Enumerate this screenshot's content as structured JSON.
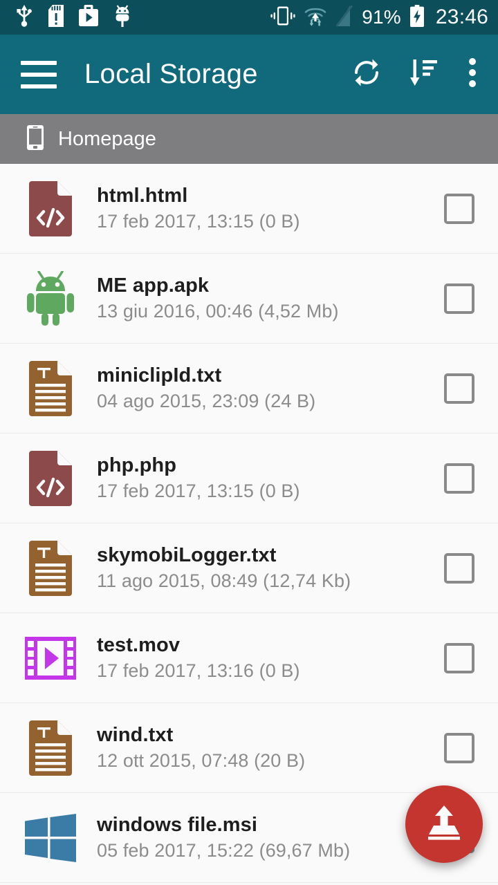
{
  "statusbar": {
    "icons_left": [
      "usb-icon",
      "sd-card-alert-icon",
      "play-store-icon",
      "android-debug-icon"
    ],
    "icons_right": [
      "vibrate-icon",
      "wifi-transfer-icon",
      "signal-off-icon"
    ],
    "battery_percent": "91%",
    "battery_state": "charging",
    "time": "23:46",
    "background_color": "#0D4E5B"
  },
  "toolbar": {
    "menu_icon": "hamburger-menu-icon",
    "title": "Local Storage",
    "actions": [
      {
        "name": "refresh",
        "icon": "refresh-icon"
      },
      {
        "name": "sort",
        "icon": "sort-descending-icon"
      },
      {
        "name": "more",
        "icon": "overflow-menu-icon"
      }
    ],
    "background_color": "#11697C"
  },
  "breadcrumb": {
    "icon": "phone-icon",
    "label": "Homepage",
    "background_color": "#7E7E80"
  },
  "files": [
    {
      "name": "html.html",
      "meta": "17 feb 2017, 13:15 (0 B)",
      "icon": "code-file-icon",
      "icon_color": "#8C4A4A",
      "checked": false
    },
    {
      "name": "ME app.apk",
      "meta": "13 giu 2016, 00:46 (4,52 Mb)",
      "icon": "android-apk-icon",
      "icon_color": "#5FA85F",
      "checked": false
    },
    {
      "name": "miniclipId.txt",
      "meta": "04 ago 2015, 23:09 (24 B)",
      "icon": "text-file-icon",
      "icon_color": "#94622E",
      "checked": false
    },
    {
      "name": "php.php",
      "meta": "17 feb 2017, 13:15 (0 B)",
      "icon": "code-file-icon",
      "icon_color": "#8C4A4A",
      "checked": false
    },
    {
      "name": "skymobiLogger.txt",
      "meta": "11 ago 2015, 08:49 (12,74 Kb)",
      "icon": "text-file-icon",
      "icon_color": "#94622E",
      "checked": false
    },
    {
      "name": "test.mov",
      "meta": "17 feb 2017, 13:16 (0 B)",
      "icon": "video-file-icon",
      "icon_color": "#C337E8",
      "checked": false
    },
    {
      "name": "wind.txt",
      "meta": "12 ott 2015, 07:48 (20 B)",
      "icon": "text-file-icon",
      "icon_color": "#94622E",
      "checked": false
    },
    {
      "name": "windows file.msi",
      "meta": "05 feb 2017, 15:22 (69,67 Mb)",
      "icon": "windows-file-icon",
      "icon_color": "#3A7CA5",
      "checked": false
    }
  ],
  "fab": {
    "icon": "upload-icon",
    "color": "#C4352F"
  }
}
